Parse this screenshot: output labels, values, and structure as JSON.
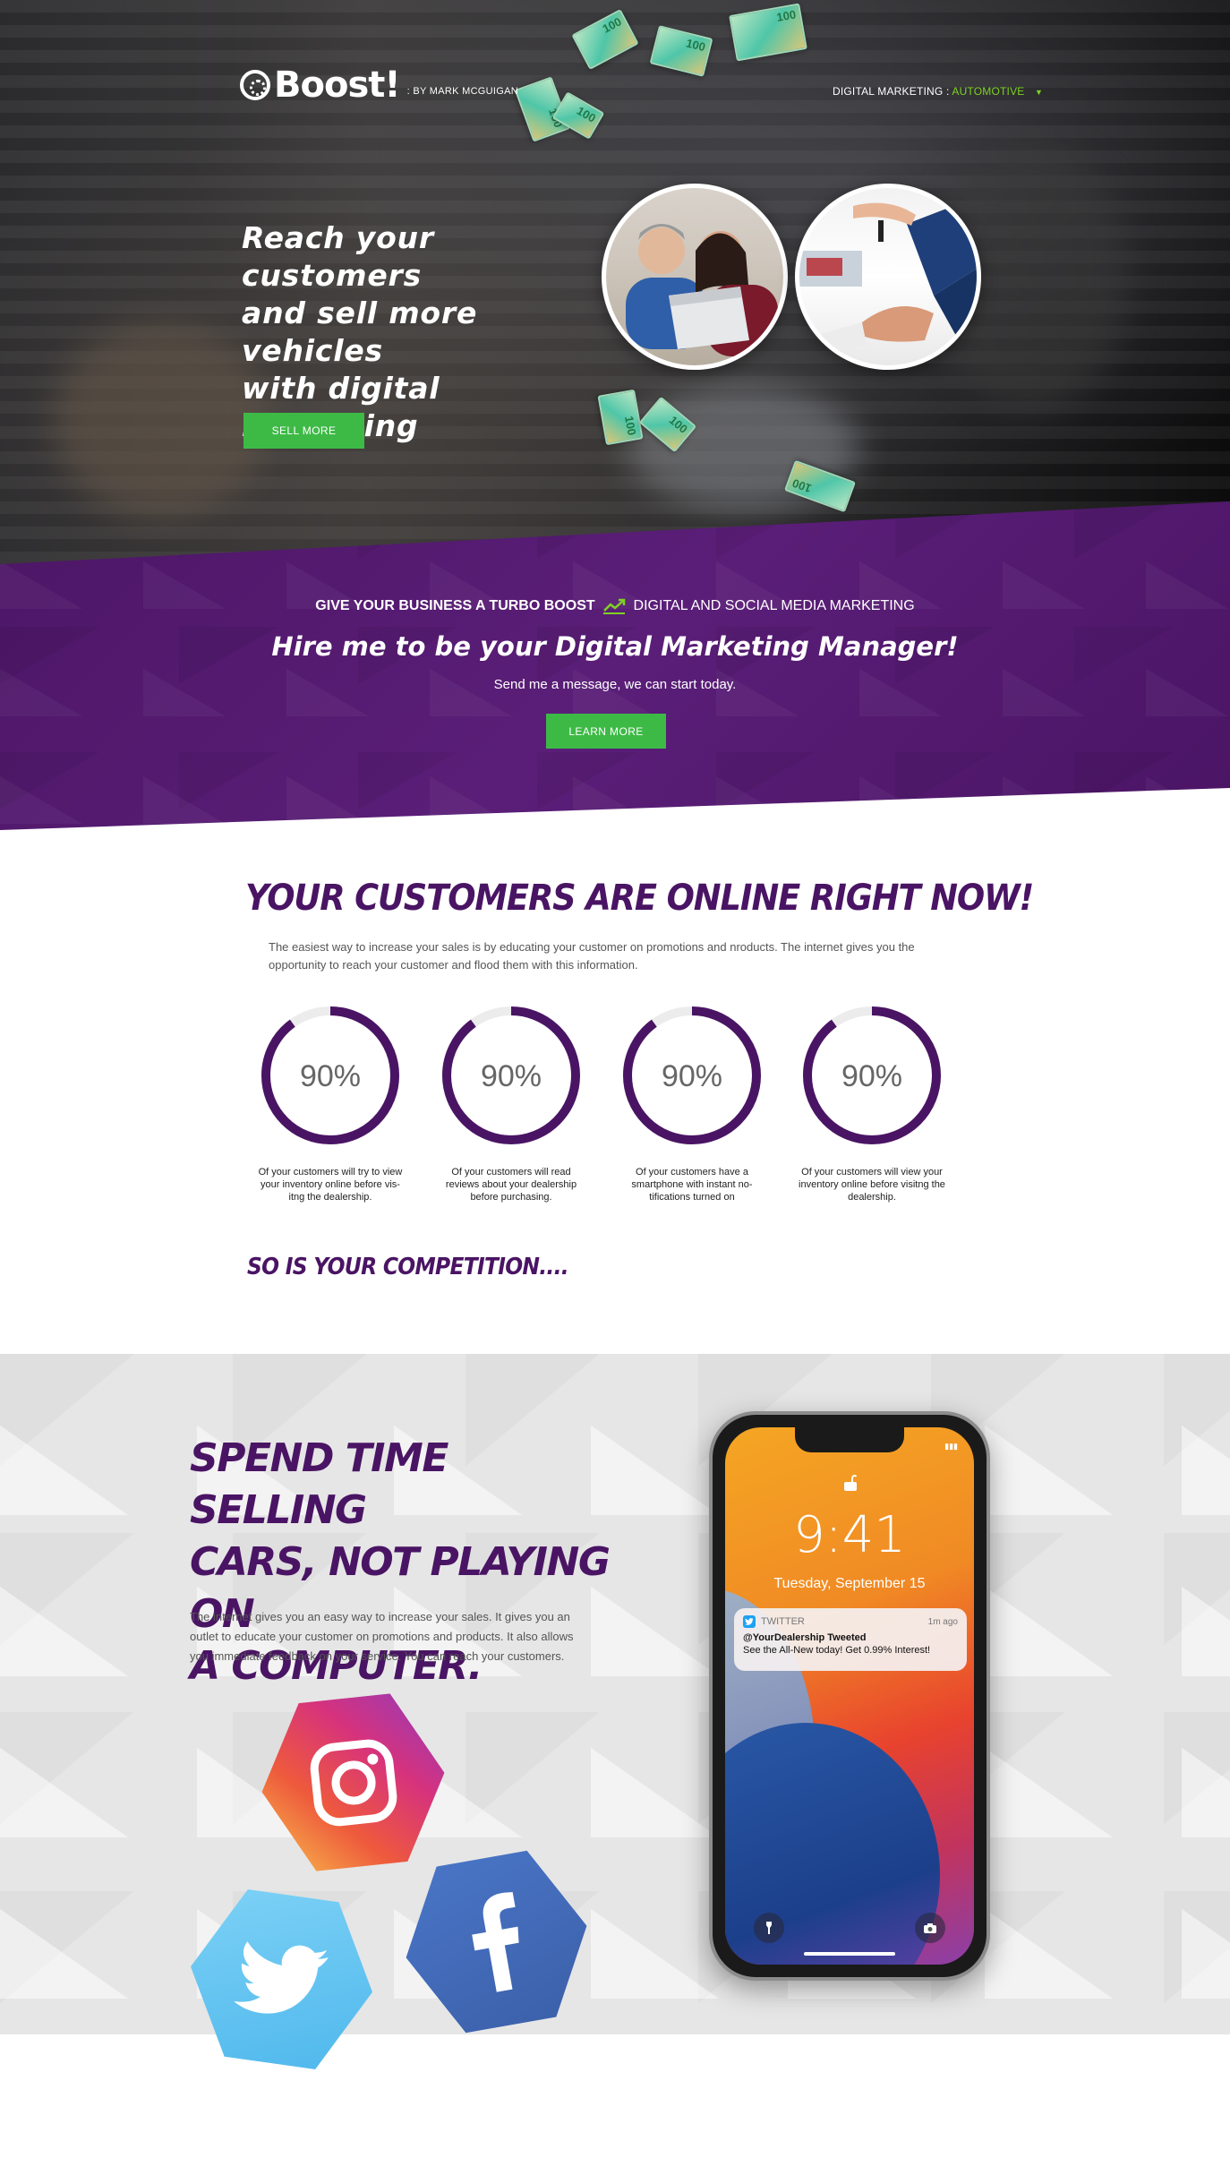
{
  "header": {
    "logo_text": "Boost!",
    "logo_byline": ": BY MARK MCGUIGAN",
    "nav_prefix": "DIGITAL MARKETING :",
    "nav_selected": "AUTOMOTIVE",
    "nav_caret": "▼"
  },
  "hero": {
    "title": "Reach your customers\nand sell more vehicles\nwith digital marketing",
    "cta_label": "SELL MORE",
    "money_label": "100"
  },
  "band": {
    "tag_bold": "GIVE YOUR BUSINESS A TURBO BOOST",
    "tag_light": "DIGITAL AND SOCIAL MEDIA MARKETING",
    "headline": "Hire me to be your Digital Marketing Manager!",
    "subline": "Send me a message, we can start today.",
    "cta_label": "LEARN MORE"
  },
  "online": {
    "heading": "YOUR CUSTOMERS ARE ONLINE RIGHT NOW!",
    "intro": "The easiest way to increase your sales is by educating your customer on promotions and nroducts. The internet gives you the opportunity to reach your customer and flood them with this information.",
    "stats": [
      {
        "value": "90%",
        "percent": 90,
        "caption": "Of your customers will try to view your inventory online before vis-itng the dealership."
      },
      {
        "value": "90%",
        "percent": 90,
        "caption": "Of your customers will read reviews about your dealership before purchasing."
      },
      {
        "value": "90%",
        "percent": 90,
        "caption": "Of your customers have a smartphone with instant no-tifications turned on"
      },
      {
        "value": "90%",
        "percent": 90,
        "caption": "Of your customers will view your inventory online before visitng the dealership."
      }
    ],
    "closing": "SO IS YOUR COMPETITION...."
  },
  "social": {
    "heading": "SPEND TIME SELLING\nCARS, NOT PLAYING ON\nA COMPUTER.",
    "body": "The internet gives you an easy way to increase your sales. It gives you an outlet to educate your customer on promotions and products. It also allows you immediate feedback on your service. You can reach your customers.",
    "icons": [
      "instagram-icon",
      "twitter-icon",
      "facebook-icon"
    ]
  },
  "phone": {
    "time": "9:41",
    "date": "Tuesday, September 15",
    "notif_app": "TWITTER",
    "notif_ago": "1m ago",
    "notif_title": "@YourDealership Tweeted",
    "notif_body": "See the All-New today! Get 0.99% Interest!"
  },
  "colors": {
    "brand_purple": "#4a1464",
    "cta_green": "#3dba46",
    "nav_accent": "#7ed321"
  }
}
